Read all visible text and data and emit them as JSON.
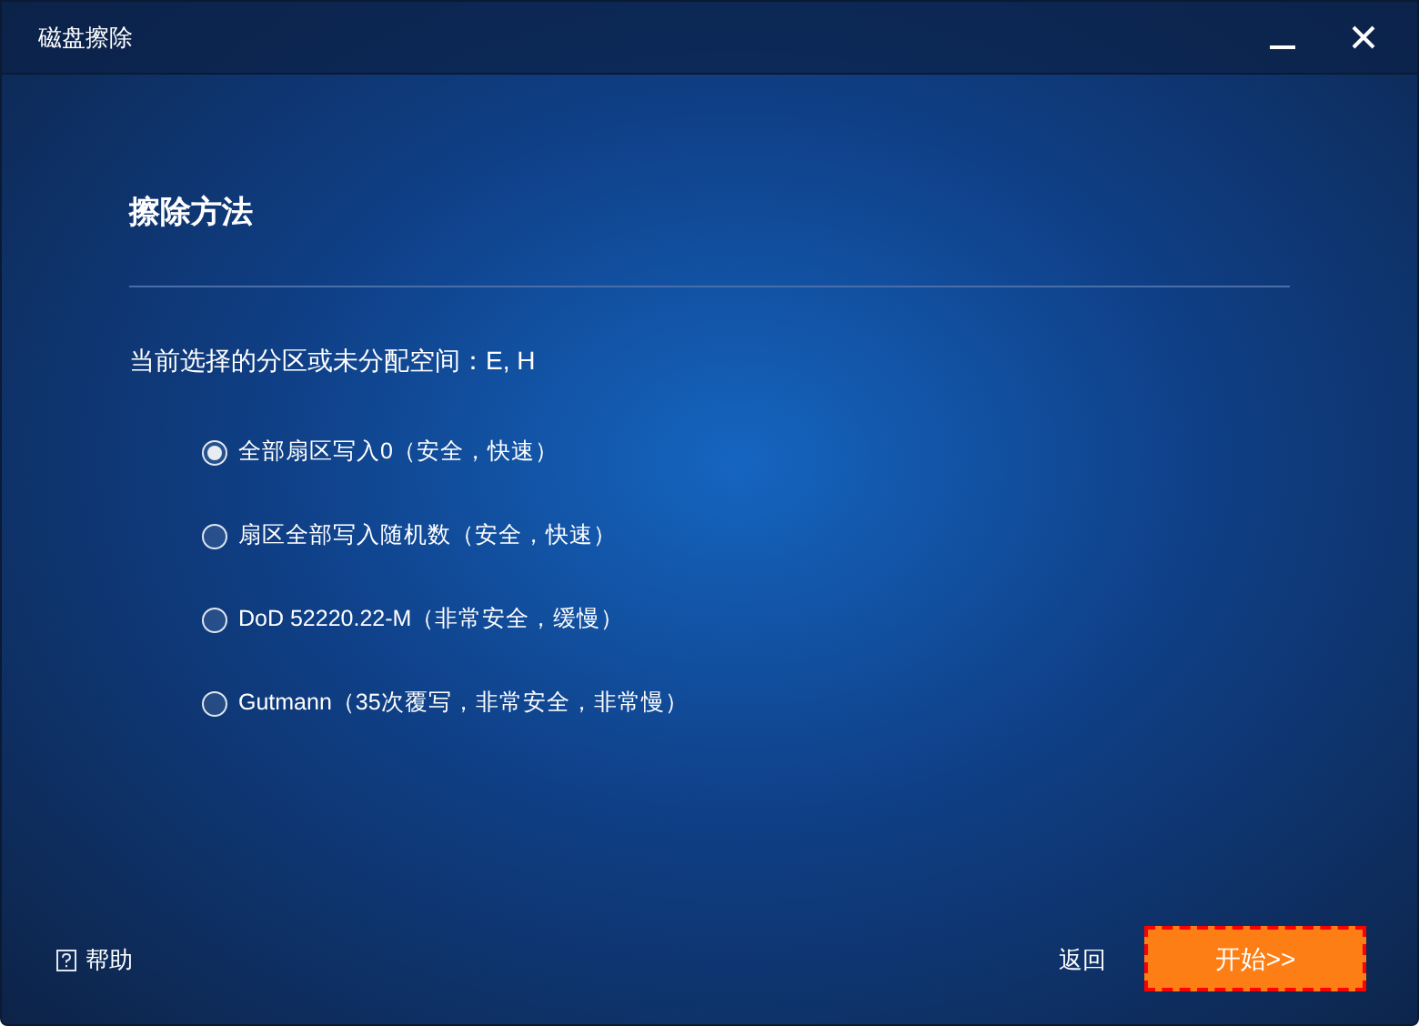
{
  "window": {
    "title": "磁盘擦除"
  },
  "heading": "擦除方法",
  "selection_label": "当前选择的分区或未分配空间：E, H",
  "options": [
    {
      "label": "全部扇区写入0（安全，快速）",
      "selected": true
    },
    {
      "label": "扇区全部写入随机数（安全，快速）",
      "selected": false
    },
    {
      "label": "DoD 52220.22-M（非常安全，缓慢）",
      "selected": false
    },
    {
      "label": "Gutmann（35次覆写，非常安全，非常慢）",
      "selected": false
    }
  ],
  "help": "帮助",
  "buttons": {
    "back": "返回",
    "start": "开始>>"
  }
}
